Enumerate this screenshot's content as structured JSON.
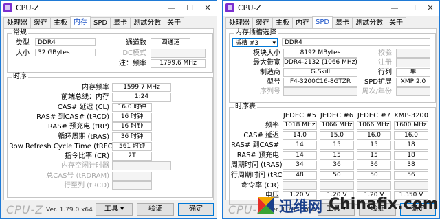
{
  "left": {
    "title": "CPU-Z",
    "window_buttons": [
      "—",
      "☐",
      "✕"
    ],
    "tabs": [
      "处理器",
      "缓存",
      "主板",
      "内存",
      "SPD",
      "显卡",
      "測試分數",
      "关于"
    ],
    "active_tab": 3,
    "general": {
      "title": "常规",
      "type_label": "类型",
      "type_value": "DDR4",
      "size_label": "大小",
      "size_value": "32 GBytes",
      "channels_label": "通道数",
      "channels_value": "四通道",
      "dc_label": "DC模式",
      "note_label": "注：频率",
      "note_value": "1799.6 MHz"
    },
    "timings": {
      "title": "时序",
      "rows": [
        {
          "label": "内存频率",
          "value": "1599.7 MHz",
          "dim": false,
          "wide": true
        },
        {
          "label": "前端总线：内存",
          "value": "1:24",
          "dim": false,
          "wide": true
        },
        {
          "label": "CAS# 延迟 (CL)",
          "value": "16.0 时钟",
          "dim": false,
          "wide": false
        },
        {
          "label": "RAS# 到CAS# (tRCD)",
          "value": "16 时钟",
          "dim": false,
          "wide": false
        },
        {
          "label": "RAS# 预充电 (tRP)",
          "value": "16 时钟",
          "dim": false,
          "wide": false
        },
        {
          "label": "循环周期 (tRAS)",
          "value": "36 时钟",
          "dim": false,
          "wide": false
        },
        {
          "label": "Row Refresh Cycle Time (tRFC)",
          "value": "561 时钟",
          "dim": false,
          "wide": false
        },
        {
          "label": "指令比率 (CR)",
          "value": "2T",
          "dim": false,
          "wide": false
        },
        {
          "label": "内存空闲计时器",
          "value": "",
          "dim": true,
          "wide": true
        },
        {
          "label": "总CAS号 (tRDRAM)",
          "value": "",
          "dim": true,
          "wide": false
        },
        {
          "label": "行至列 (tRCD)",
          "value": "",
          "dim": true,
          "wide": false
        }
      ]
    },
    "bottom": {
      "brand": "CPU-Z",
      "version": "Ver. 1.79.0.x64",
      "tools": "工具",
      "validate": "验证",
      "ok": "确定"
    }
  },
  "right": {
    "title": "CPU-Z",
    "window_buttons": [
      "—",
      "☐",
      "✕"
    ],
    "tabs": [
      "处理器",
      "缓存",
      "主板",
      "内存",
      "SPD",
      "显卡",
      "測試分數",
      "关于"
    ],
    "active_tab": 4,
    "slot": {
      "title": "内存插槽选择",
      "slot_value": "插槽 #3",
      "type_value": "DDR4",
      "module_size_label": "模块大小",
      "module_size_value": "8192 MBytes",
      "max_bw_label": "最大带宽",
      "max_bw_value": "DDR4-2132 (1066 MHz)",
      "maker_label": "制造商",
      "maker_value": "G.Skill",
      "part_label": "型号",
      "part_value": "F4-3200C16-8GTZR",
      "serial_label": "序列号",
      "correction_label": "校验",
      "registered_label": "注册",
      "ranks_label": "行列",
      "ranks_value": "单",
      "spd_ext_label": "SPD扩展",
      "spd_ext_value": "XMP 2.0",
      "week_year_label": "周次/年份"
    },
    "timing_table": {
      "title": "时序表",
      "columns": [
        "JEDEC #5",
        "JEDEC #6",
        "JEDEC #7",
        "XMP-3200"
      ],
      "rows": [
        {
          "label": "频率",
          "values": [
            "1018 MHz",
            "1066 MHz",
            "1066 MHz",
            "1600 MHz"
          ]
        },
        {
          "label": "CAS# 延迟",
          "values": [
            "14.0",
            "15.0",
            "16.0",
            "16.0"
          ]
        },
        {
          "label": "RAS# 到CAS#",
          "values": [
            "14",
            "15",
            "15",
            "18"
          ]
        },
        {
          "label": "RAS# 预充电",
          "values": [
            "14",
            "15",
            "15",
            "18"
          ]
        },
        {
          "label": "周期时间 (tRAS)",
          "values": [
            "34",
            "36",
            "36",
            "38"
          ]
        },
        {
          "label": "行周期时间 (tRC)",
          "values": [
            "48",
            "50",
            "50",
            "56"
          ]
        },
        {
          "label": "命令率 (CR)",
          "values": [
            "",
            "",
            "",
            ""
          ]
        },
        {
          "label": "电压",
          "values": [
            "1.20 V",
            "1.20 V",
            "1.20 V",
            "1.350 V"
          ]
        }
      ]
    },
    "bottom": {
      "brand": "CPU-Z",
      "version": "Ver. 1.79.0.x64",
      "tools": "工具",
      "validate": "验证",
      "ok": "确定"
    }
  },
  "watermark": {
    "text1": "迅维网",
    "text2": "Chinafix.com"
  },
  "colors": {
    "accent_blue": "#1e55c8",
    "window_border": "#1f7ad6",
    "watermark_blue": "#1a3f8a"
  }
}
